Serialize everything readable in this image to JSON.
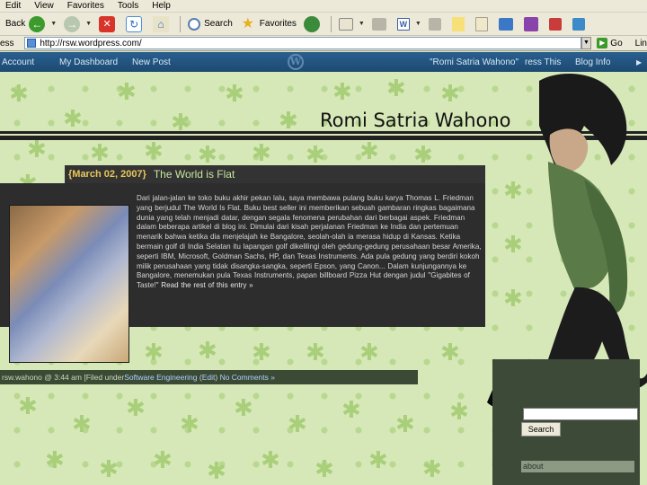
{
  "menu": [
    "Edit",
    "View",
    "Favorites",
    "Tools",
    "Help"
  ],
  "toolbar": {
    "back_label": "Back",
    "search_label": "Search",
    "favorites_label": "Favorites"
  },
  "address": {
    "label": "ess",
    "url": "http://rsw.wordpress.com/",
    "go_label": "Go",
    "links_label": "Lin"
  },
  "wpbar": {
    "account": "Account",
    "dashboard": "My Dashboard",
    "new_post": "New Post",
    "blog_name": "\"Romi Satria Wahono\"",
    "press_this": "ress This",
    "blog_info": "Blog Info"
  },
  "site": {
    "title": "Romi Satria Wahono"
  },
  "post": {
    "date": "{March 02, 2007}",
    "title": "The World is Flat",
    "body": "Dari jalan-jalan ke toko buku akhir pekan lalu, saya membawa pulang buku karya Thomas L. Friedman yang berjudul The World Is Flat. Buku best seller ini memberikan sebuah gambaran ringkas bagaimana dunia yang telah menjadi datar, dengan segala fenomena perubahan dari berbagai aspek. Friedman dalam beberapa artikel di blog ini. Dimulai dari kisah perjalanan Friedman ke India dan pertemuan menarik bahwa ketika dia menjelajah ke Bangalore, seolah-olah ia merasa hidup di Kansas. Ketika bermain golf di India Selatan itu lapangan golf dikelilingi oleh gedung-gedung perusahaan besar Amerika, seperti IBM, Microsoft, Goldman Sachs, HP, dan Texas Instruments. Ada pula gedung yang berdiri kokoh milik perusahaan yang tidak disangka-sangka, seperti Epson, yang Canon... Dalam kunjungannya ke Bangalore, menemukan pula Texas Instruments, papan billboard Pizza Hut dengan judul \"Gigabites of Taste!\"",
    "more": "Read the rest of this entry »",
    "footer_author": "rsw.wahono @ 3:44 am",
    "footer_filed": "[Filed under ",
    "footer_category": "Software Engineering",
    "footer_edit": "Edit",
    "footer_comments": "No Comments »"
  },
  "sidebar": {
    "search_button": "Search",
    "about_label": "about"
  }
}
